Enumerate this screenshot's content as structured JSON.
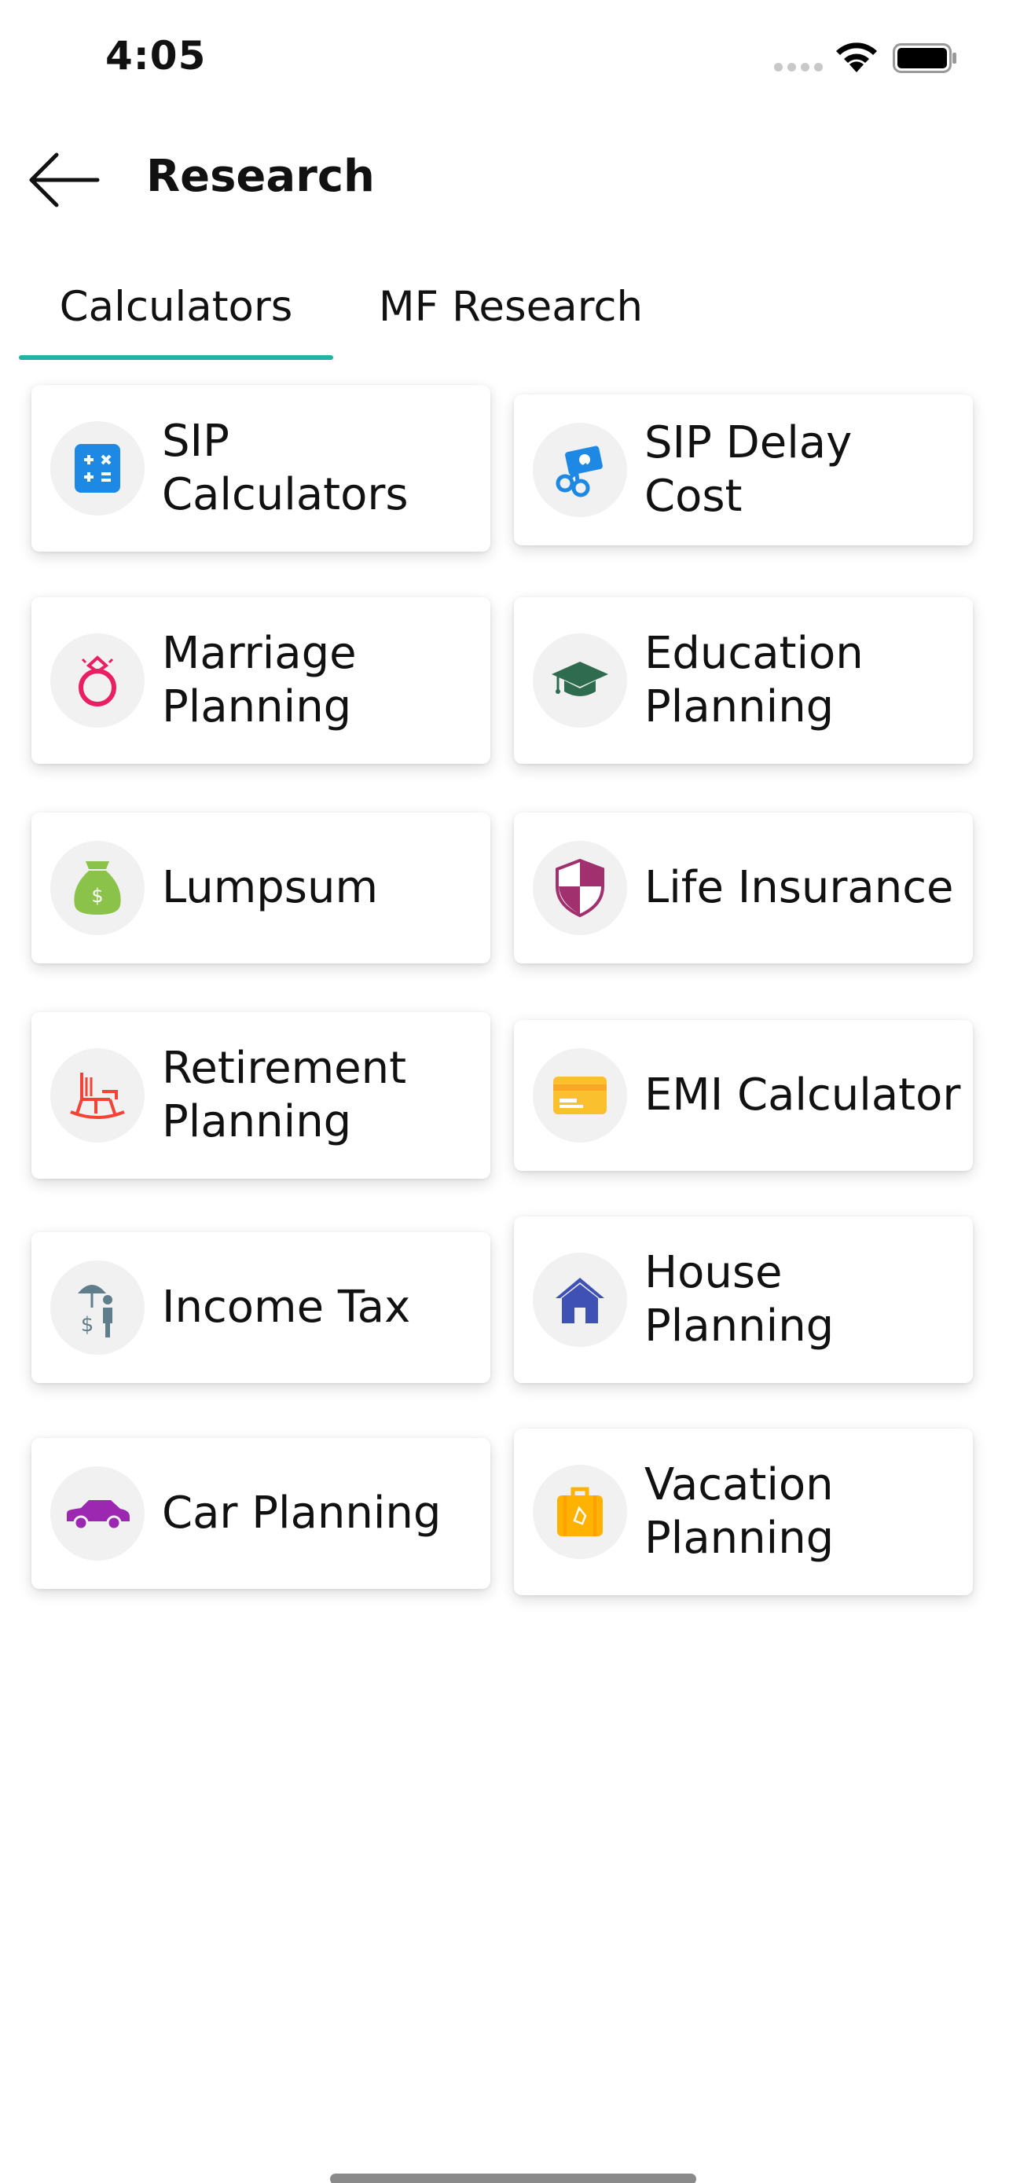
{
  "status_bar": {
    "time": "4:05"
  },
  "header": {
    "title": "Research"
  },
  "tabs": [
    {
      "label": "Calculators",
      "active": true
    },
    {
      "label": "MF Research",
      "active": false
    }
  ],
  "accent_color": "#22b3a3",
  "cards": [
    {
      "label": "SIP Calculators",
      "icon": "calculator-icon",
      "color": "#1e88e5"
    },
    {
      "label": "SIP Delay Cost",
      "icon": "money-cut-icon",
      "color": "#1e88e5"
    },
    {
      "label": "Marriage Planning",
      "icon": "ring-icon",
      "color": "#e91e63"
    },
    {
      "label": "Education Planning",
      "icon": "graduation-cap-icon",
      "color": "#2e6b4f"
    },
    {
      "label": "Lumpsum",
      "icon": "money-bag-icon",
      "color": "#8bc34a"
    },
    {
      "label": "Life Insurance",
      "icon": "shield-icon",
      "color": "#a0306e"
    },
    {
      "label": "Retirement Planning",
      "icon": "rocking-chair-icon",
      "color": "#f44336"
    },
    {
      "label": "EMI Calculator",
      "icon": "credit-card-icon",
      "color": "#fbc02d"
    },
    {
      "label": "Income Tax",
      "icon": "umbrella-person-icon",
      "color": "#607d8b"
    },
    {
      "label": "House Planning",
      "icon": "house-icon",
      "color": "#3f51b5"
    },
    {
      "label": "Car Planning",
      "icon": "car-icon",
      "color": "#9c27b0"
    },
    {
      "label": "Vacation Planning",
      "icon": "suitcase-icon",
      "color": "#ffb300"
    }
  ]
}
